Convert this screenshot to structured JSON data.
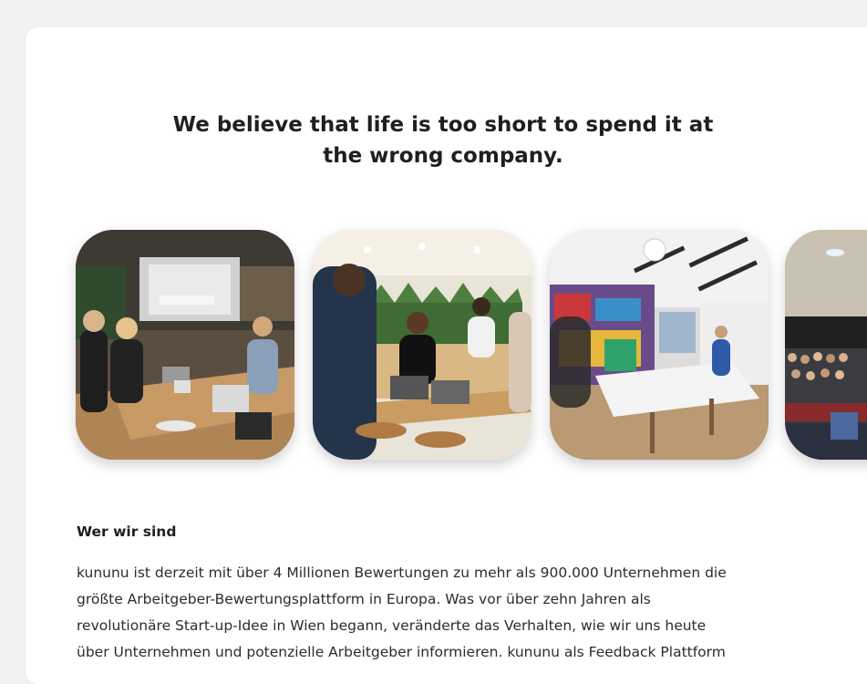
{
  "headline": {
    "line1": "We believe that life is too short to spend it at",
    "line2": "the wrong company."
  },
  "gallery": {
    "photos": [
      {
        "subject": "meeting-room-photo"
      },
      {
        "subject": "open-office-photo"
      },
      {
        "subject": "table-tennis-room-photo"
      },
      {
        "subject": "event-audience-photo"
      }
    ]
  },
  "about": {
    "title": "Wer wir sind",
    "lines": [
      "kununu ist derzeit mit über 4 Millionen Bewertungen zu mehr als 900.000 Unternehmen die",
      "größte Arbeitgeber-Bewertungsplattform in Europa. Was vor über zehn Jahren als",
      "revolutionäre Start-up-Idee in Wien begann, veränderte das Verhalten, wie wir uns heute",
      "über Unternehmen und potenzielle Arbeitgeber informieren. kununu als Feedback Plattform"
    ]
  }
}
